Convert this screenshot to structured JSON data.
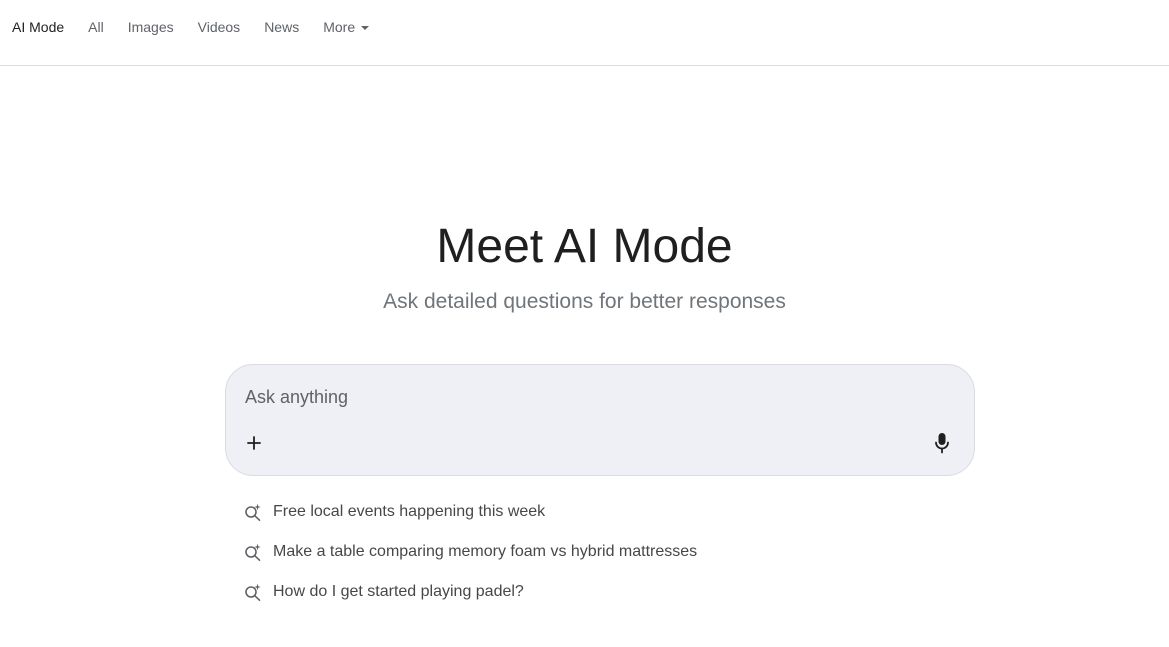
{
  "nav": {
    "tabs": [
      {
        "label": "AI Mode",
        "active": true
      },
      {
        "label": "All"
      },
      {
        "label": "Images"
      },
      {
        "label": "Videos"
      },
      {
        "label": "News"
      },
      {
        "label": "More",
        "has_dropdown": true
      }
    ]
  },
  "hero": {
    "title": "Meet AI Mode",
    "subtitle": "Ask detailed questions for better responses"
  },
  "search": {
    "placeholder": "Ask anything",
    "value": "",
    "add_icon": "plus-icon",
    "voice_icon": "microphone-icon"
  },
  "suggestions": {
    "icon": "search-sparkle-icon",
    "items": [
      "Free local events happening this week",
      "Make a table comparing memory foam vs hybrid mattresses",
      "How do I get started playing padel?"
    ]
  },
  "colors": {
    "background": "#ffffff",
    "search_box": "#eff0f5",
    "divider": "#dadce0",
    "title": "#1f1f1f",
    "subtitle": "#70757a",
    "tab_inactive": "#5f6368"
  }
}
